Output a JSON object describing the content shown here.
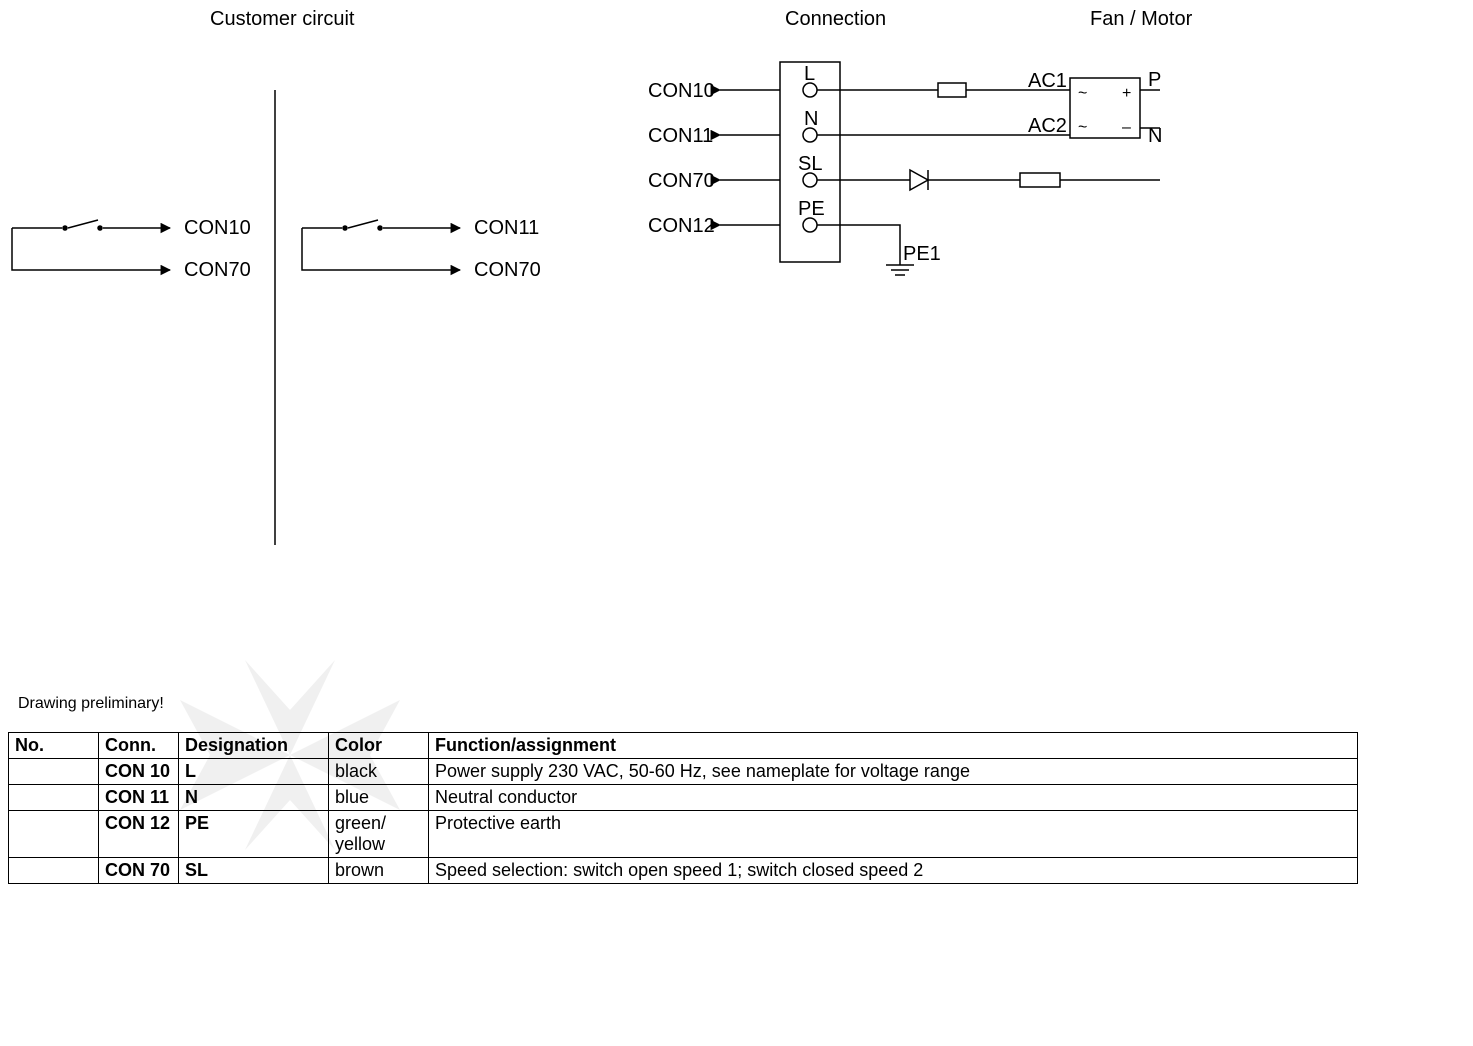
{
  "headers": {
    "customer": "Customer circuit",
    "connection": "Connection",
    "fanmotor": "Fan / Motor"
  },
  "customer_labels": {
    "c10": "CON10",
    "c70": "CON70",
    "c11": "CON11",
    "c70b": "CON70"
  },
  "conn_labels": {
    "c10": "CON10",
    "c11": "CON11",
    "c70": "CON70",
    "c12": "CON12",
    "L": "L",
    "N": "N",
    "SL": "SL",
    "PE": "PE",
    "PE1": "PE1",
    "AC1": "AC1",
    "AC2": "AC2",
    "P": "P",
    "Nout": "N",
    "tilde1": "~",
    "tilde2": "~",
    "plus": "+",
    "minus": "–"
  },
  "note": "Drawing preliminary!",
  "table": {
    "headers": {
      "no": "No.",
      "conn": "Conn.",
      "designation": "Designation",
      "color": "Color",
      "function": "Function/assignment"
    },
    "rows": [
      {
        "no": "",
        "conn": "CON 10",
        "designation": "L",
        "color": "black",
        "function": "Power supply 230 VAC, 50-60 Hz, see nameplate for voltage range"
      },
      {
        "no": "",
        "conn": "CON 11",
        "designation": "N",
        "color": "blue",
        "function": "Neutral conductor"
      },
      {
        "no": "",
        "conn": "CON 12",
        "designation": "PE",
        "color": "green/ yellow",
        "function": "Protective earth"
      },
      {
        "no": "",
        "conn": "CON 70",
        "designation": "SL",
        "color": "brown",
        "function": "Speed selection: switch open speed 1; switch closed speed 2"
      }
    ]
  }
}
